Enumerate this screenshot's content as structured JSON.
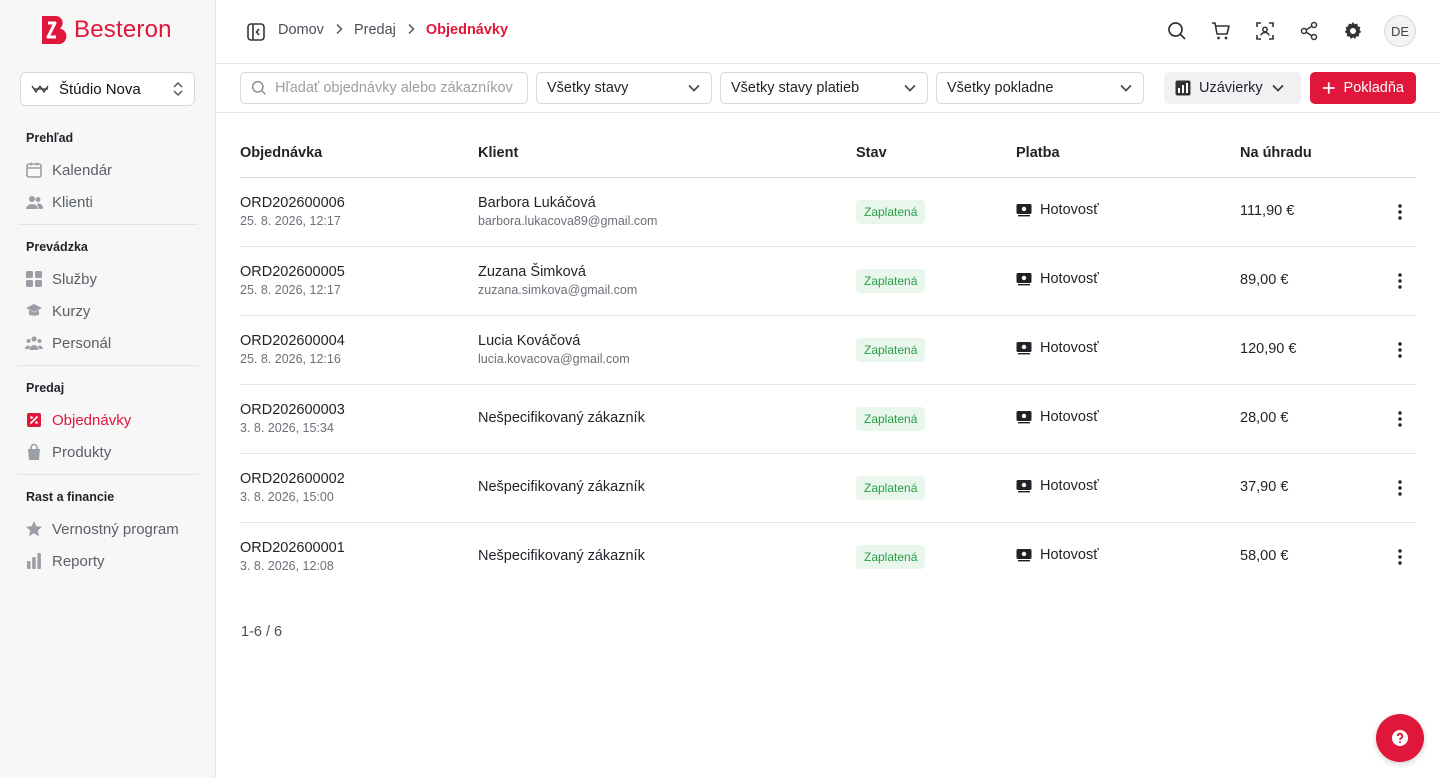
{
  "app": {
    "name": "Besteron",
    "brand_color": "#e0173a"
  },
  "studio": {
    "name": "Štúdio Nova"
  },
  "sidebar": {
    "sections": [
      {
        "title": "Prehľad",
        "items": [
          {
            "label": "Kalendár",
            "icon": "calendar-icon"
          },
          {
            "label": "Klienti",
            "icon": "users-icon"
          }
        ]
      },
      {
        "title": "Prevádzka",
        "items": [
          {
            "label": "Služby",
            "icon": "grid-icon"
          },
          {
            "label": "Kurzy",
            "icon": "graduation-cap-icon"
          },
          {
            "label": "Personál",
            "icon": "team-icon"
          }
        ]
      },
      {
        "title": "Predaj",
        "items": [
          {
            "label": "Objednávky",
            "icon": "receipt-icon",
            "active": true
          },
          {
            "label": "Produkty",
            "icon": "shopping-bag-icon"
          }
        ]
      },
      {
        "title": "Rast a financie",
        "items": [
          {
            "label": "Vernostný program",
            "icon": "star-icon"
          },
          {
            "label": "Reporty",
            "icon": "bar-chart-icon"
          }
        ]
      }
    ]
  },
  "breadcrumb": [
    "Domov",
    "Predaj",
    "Objednávky"
  ],
  "user": {
    "initials": "DE"
  },
  "filters": {
    "search_placeholder": "Hľadať objednávky alebo zákazníkov",
    "status": "Všetky stavy",
    "payment_status": "Všetky stavy platieb",
    "register": "Všetky pokladne",
    "closings_label": "Uzávierky",
    "new_register_label": "Pokladňa"
  },
  "table": {
    "headers": [
      "Objednávka",
      "Klient",
      "Stav",
      "Platba",
      "Na úhradu"
    ],
    "rows": [
      {
        "id": "ORD202600006",
        "date": "25. 8. 2026, 12:17",
        "client": "Barbora Lukáčová",
        "email": "barbora.lukacova89@gmail.com",
        "status": "Zaplatená",
        "payment": "Hotovosť",
        "amount": "111,90 €"
      },
      {
        "id": "ORD202600005",
        "date": "25. 8. 2026, 12:17",
        "client": "Zuzana Šimková",
        "email": "zuzana.simkova@gmail.com",
        "status": "Zaplatená",
        "payment": "Hotovosť",
        "amount": "89,00 €"
      },
      {
        "id": "ORD202600004",
        "date": "25. 8. 2026, 12:16",
        "client": "Lucia Kováčová",
        "email": "lucia.kovacova@gmail.com",
        "status": "Zaplatená",
        "payment": "Hotovosť",
        "amount": "120,90 €"
      },
      {
        "id": "ORD202600003",
        "date": "3. 8. 2026, 15:34",
        "client": "Nešpecifikovaný zákazník",
        "email": "",
        "status": "Zaplatená",
        "payment": "Hotovosť",
        "amount": "28,00 €"
      },
      {
        "id": "ORD202600002",
        "date": "3. 8. 2026, 15:00",
        "client": "Nešpecifikovaný zákazník",
        "email": "",
        "status": "Zaplatená",
        "payment": "Hotovosť",
        "amount": "37,90 €"
      },
      {
        "id": "ORD202600001",
        "date": "3. 8. 2026, 12:08",
        "client": "Nešpecifikovaný zákazník",
        "email": "",
        "status": "Zaplatená",
        "payment": "Hotovosť",
        "amount": "58,00 €"
      }
    ]
  },
  "pagination": "1-6 / 6"
}
